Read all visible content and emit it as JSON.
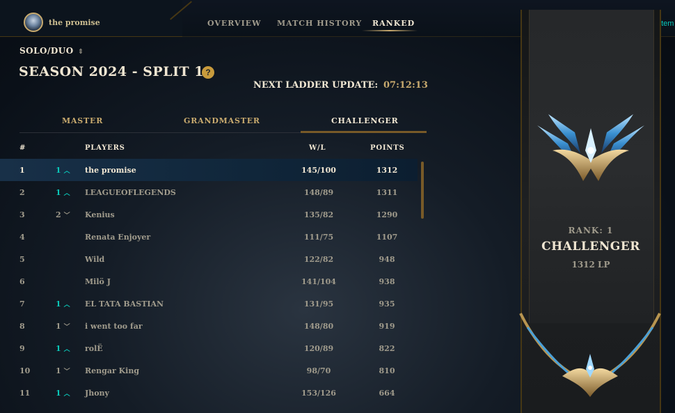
{
  "profile": {
    "name": "the promise",
    "avatar_icon": "profile-avatar"
  },
  "nav": {
    "tabs": [
      {
        "label": "OVERVIEW",
        "active": false
      },
      {
        "label": "MATCH HISTORY",
        "active": false
      },
      {
        "label": "RANKED",
        "active": true
      }
    ],
    "league_link": "League System"
  },
  "queue": {
    "selected": "SOLO/DUO"
  },
  "season": {
    "title": "SEASON 2024 - SPLIT 1",
    "help_icon": "question-mark-icon"
  },
  "ladder": {
    "label": "NEXT LADDER UPDATE:",
    "time": "07:12:13"
  },
  "tier_tabs": [
    {
      "label": "MASTER",
      "active": false
    },
    {
      "label": "GRANDMASTER",
      "active": false
    },
    {
      "label": "CHALLENGER",
      "active": true
    }
  ],
  "table": {
    "headers": {
      "rank": "#",
      "players": "PLAYERS",
      "wl": "W/L",
      "points": "POINTS"
    },
    "rows": [
      {
        "rank": "1",
        "move": "1",
        "dir": "up",
        "name": "the promise",
        "wl": "145/100",
        "points": "1312",
        "selected": true
      },
      {
        "rank": "2",
        "move": "1",
        "dir": "up",
        "name": "LEAGUEOFLEGENDS",
        "wl": "148/89",
        "points": "1311"
      },
      {
        "rank": "3",
        "move": "2",
        "dir": "down",
        "name": "Kenius",
        "wl": "135/82",
        "points": "1290"
      },
      {
        "rank": "4",
        "move": "",
        "dir": "",
        "name": "Renata Enjoyer",
        "wl": "111/75",
        "points": "1107"
      },
      {
        "rank": "5",
        "move": "",
        "dir": "",
        "name": "Wild",
        "wl": "122/82",
        "points": "948"
      },
      {
        "rank": "6",
        "move": "",
        "dir": "",
        "name": "Milö J",
        "wl": "141/104",
        "points": "938"
      },
      {
        "rank": "7",
        "move": "1",
        "dir": "up",
        "name": "EL TATA BASTIAN",
        "wl": "131/95",
        "points": "935"
      },
      {
        "rank": "8",
        "move": "1",
        "dir": "down",
        "name": "i went too far",
        "wl": "148/80",
        "points": "919"
      },
      {
        "rank": "9",
        "move": "1",
        "dir": "up",
        "name": "rolË",
        "wl": "120/89",
        "points": "822"
      },
      {
        "rank": "10",
        "move": "1",
        "dir": "down",
        "name": "Rengar King",
        "wl": "98/70",
        "points": "810"
      },
      {
        "rank": "11",
        "move": "1",
        "dir": "up",
        "name": "Jhony",
        "wl": "153/126",
        "points": "664"
      }
    ]
  },
  "rank_card": {
    "rank_label": "RANK: 1",
    "tier": "CHALLENGER",
    "lp": "1312 LP",
    "emblem_icon": "challenger-emblem-icon"
  },
  "colors": {
    "gold": "#c8aa6e",
    "teal": "#0ac8b9",
    "text": "#f0e6d2",
    "muted": "#a09b8c"
  }
}
